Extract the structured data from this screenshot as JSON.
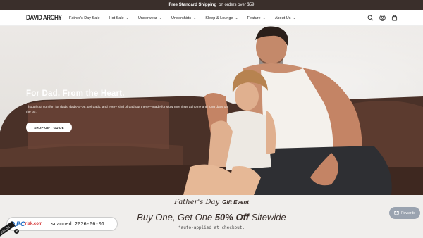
{
  "announcement": {
    "bold": "Free Standard Shipping",
    "rest": "on orders over $59"
  },
  "header": {
    "logo": "DAVID ARCHY",
    "nav": [
      {
        "label": "Father's Day Sale",
        "dropdown": false
      },
      {
        "label": "Hot Sale",
        "dropdown": true
      },
      {
        "label": "Underwear",
        "dropdown": true
      },
      {
        "label": "Undershirts",
        "dropdown": true
      },
      {
        "label": "Sleep & Lounge",
        "dropdown": true
      },
      {
        "label": "Feature",
        "dropdown": true
      },
      {
        "label": "About Us",
        "dropdown": true
      }
    ],
    "icons": [
      "search-icon",
      "account-icon",
      "cart-icon"
    ]
  },
  "hero": {
    "title": "For Dad. From the Heart.",
    "subtitle": "Thoughtful comfort for dads, dads-to-be, gel dads, and every kind of dad out there—made for slow mornings at home and long days on the go.",
    "button": "SHOP GIFT GUIDE"
  },
  "promo": {
    "script": "Father's Day",
    "event": "Gift Event",
    "main_pre": "Buy One, Get One",
    "main_bold": "50% Off",
    "main_post": "Sitewide",
    "note": "*auto-applied at checkout."
  },
  "rewards": {
    "label": "Rewards"
  },
  "scan_badge": {
    "logo_pc": "PC",
    "logo_risk": "risk.com",
    "text": "scanned 2026-06-01",
    "ribbon": "20% ON"
  },
  "colors": {
    "announce_bg": "#3a2f2b",
    "promo_bg": "#f0eeec",
    "rewards_bg": "#9aa3b0"
  }
}
